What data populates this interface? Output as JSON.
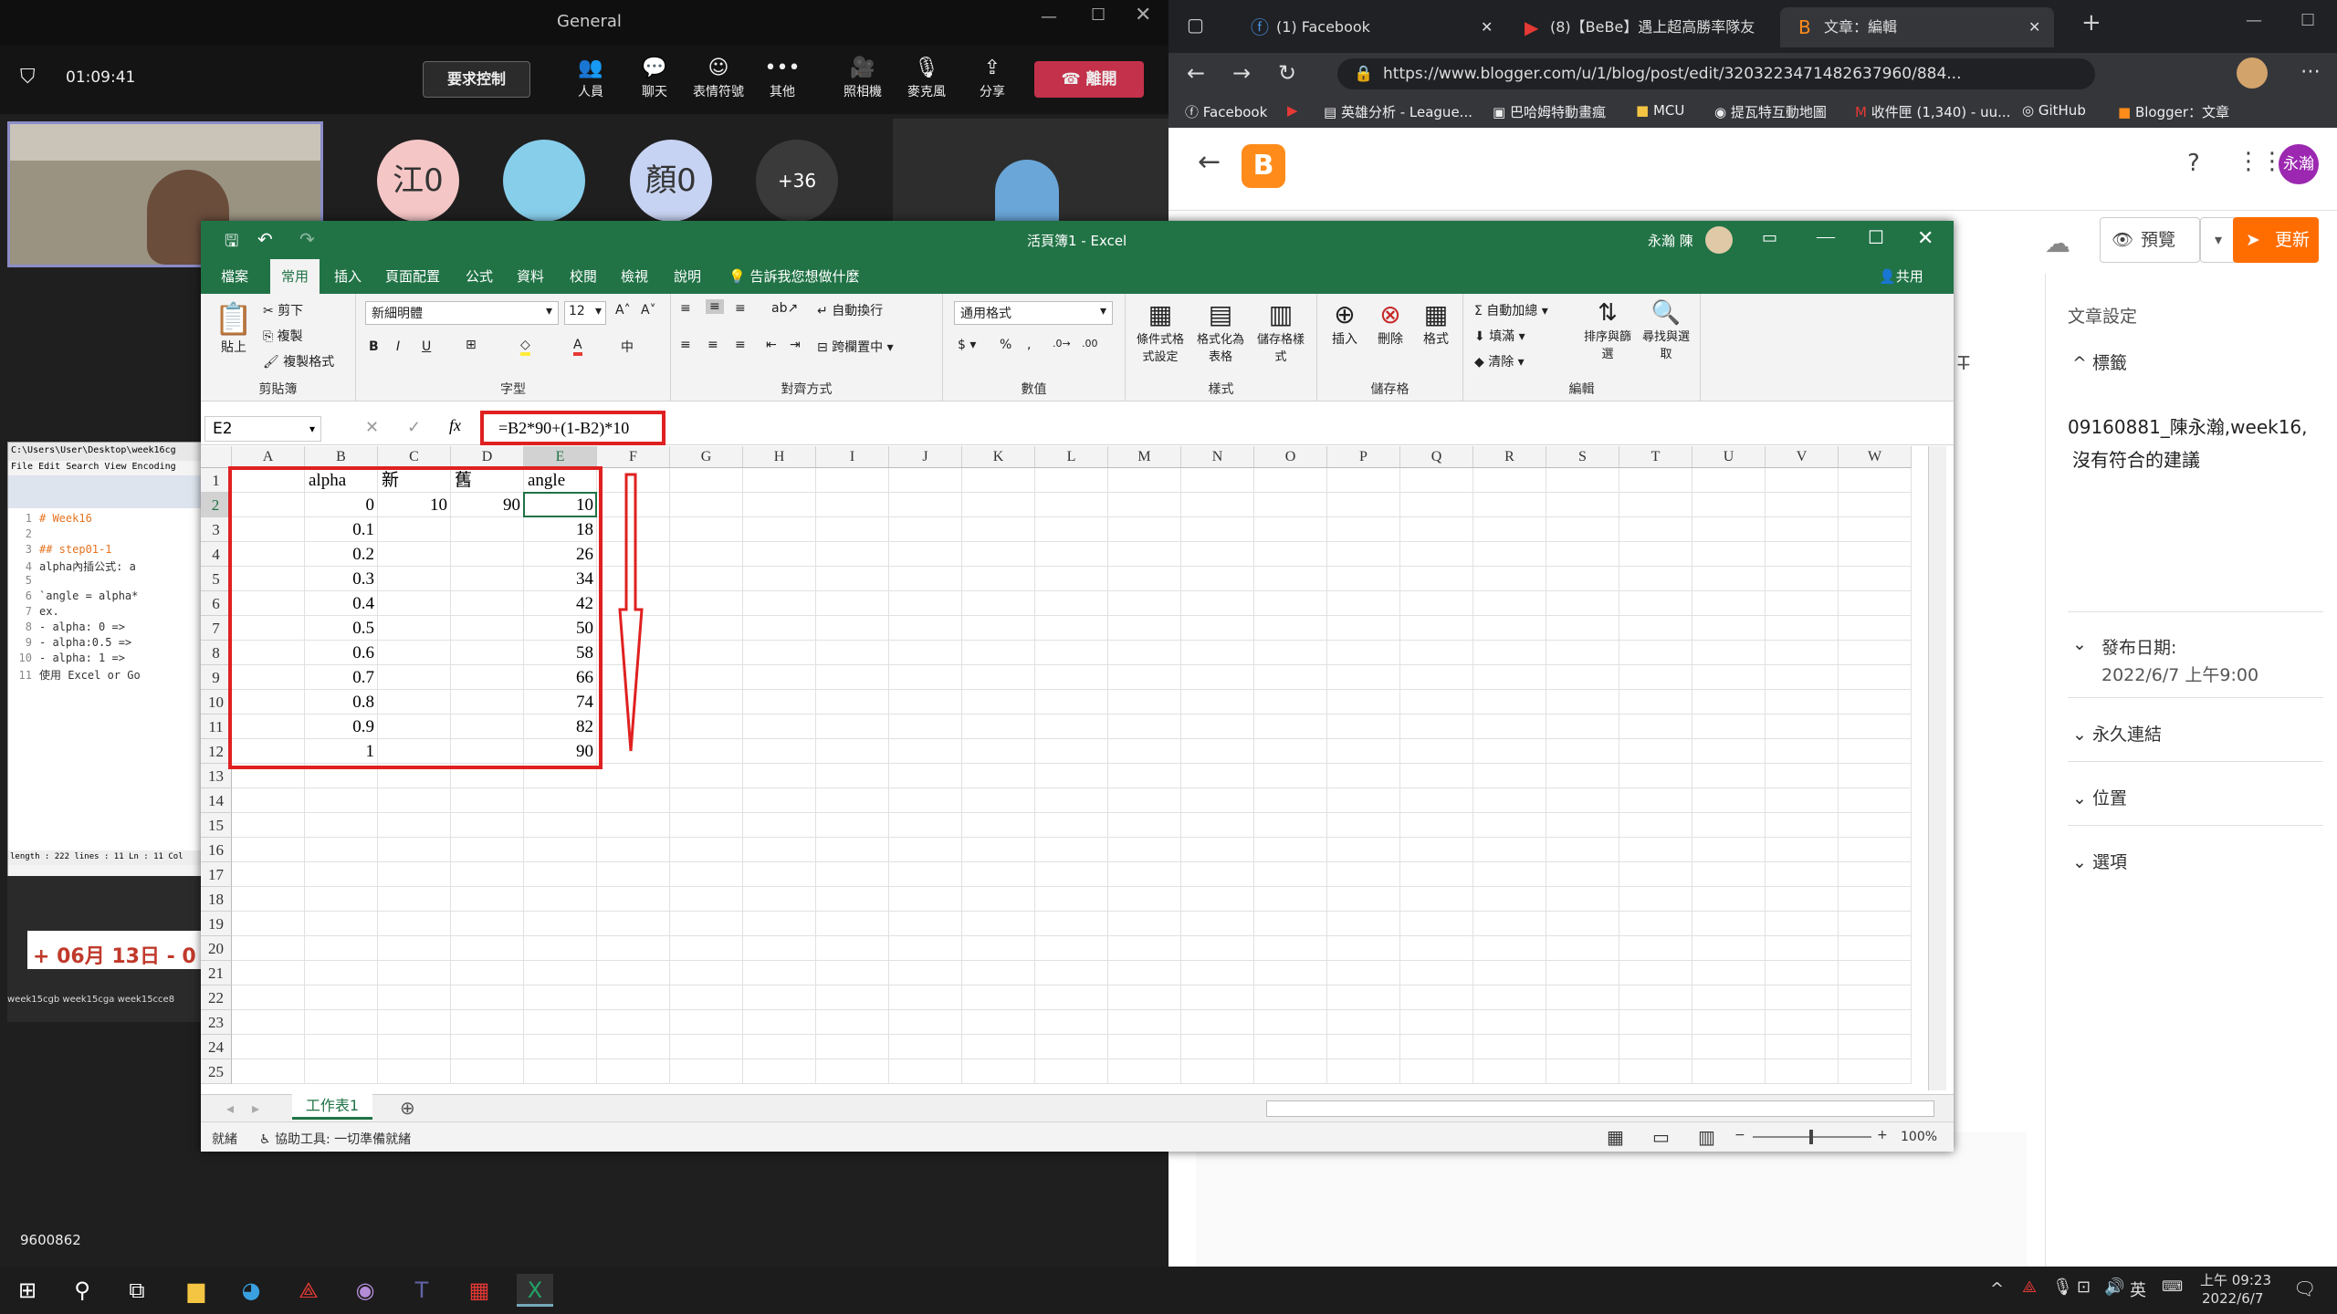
{
  "teams": {
    "title": "General",
    "timer": "01:09:41",
    "request_control": "要求控制",
    "buttons": [
      {
        "label": "人員",
        "icon": "people-icon"
      },
      {
        "label": "聊天",
        "icon": "chat-icon"
      },
      {
        "label": "表情符號",
        "icon": "emoji-icon"
      },
      {
        "label": "其他",
        "icon": "more-icon"
      },
      {
        "label": "照相機",
        "icon": "camera-off-icon"
      },
      {
        "label": "麥克風",
        "icon": "mic-off-icon"
      },
      {
        "label": "分享",
        "icon": "share-icon"
      }
    ],
    "leave": "離開",
    "participants": [
      {
        "label": "江0",
        "color": "#f5c6c6"
      },
      {
        "label": "",
        "color": "#87ceeb"
      },
      {
        "label": "顏0",
        "color": "#c7d3f2"
      },
      {
        "label": "+36",
        "color": "#3a3a3a"
      }
    ],
    "bottom_id": "9600862"
  },
  "excel": {
    "title": "活頁簿1 - Excel",
    "user": "永瀚 陳",
    "share": "共用",
    "tabs": [
      "檔案",
      "常用",
      "插入",
      "頁面配置",
      "公式",
      "資料",
      "校閱",
      "檢視",
      "說明"
    ],
    "tell_me": "告訴我您想做什麼",
    "ribbon": {
      "clipboard": {
        "label": "剪貼簿",
        "paste": "貼上",
        "cut": "剪下",
        "copy": "複製",
        "format_painter": "複製格式"
      },
      "font": {
        "label": "字型",
        "name": "新細明體",
        "size": "12"
      },
      "alignment": {
        "label": "對齊方式",
        "wrap": "自動換行",
        "merge": "跨欄置中"
      },
      "number": {
        "label": "數值",
        "format": "通用格式"
      },
      "styles": {
        "label": "樣式",
        "cond": "條件式格式設定",
        "table": "格式化為表格",
        "cell": "儲存格樣式"
      },
      "cells": {
        "label": "儲存格",
        "insert": "插入",
        "delete": "刪除",
        "format": "格式"
      },
      "editing": {
        "label": "編輯",
        "autosum": "自動加總",
        "fill": "填滿",
        "clear": "清除",
        "sort": "排序與篩選",
        "find": "尋找與選取"
      }
    },
    "name_box": "E2",
    "formula": "=B2*90+(1-B2)*10",
    "columns": [
      "A",
      "B",
      "C",
      "D",
      "E",
      "F",
      "G",
      "H",
      "I",
      "J",
      "K",
      "L",
      "M",
      "N",
      "O",
      "P",
      "Q",
      "R",
      "S",
      "T",
      "U",
      "V",
      "W"
    ],
    "rows": [
      "1",
      "2",
      "3",
      "4",
      "5",
      "6",
      "7",
      "8",
      "9",
      "10",
      "11",
      "12",
      "13",
      "14",
      "15",
      "16",
      "17",
      "18",
      "19",
      "20",
      "21",
      "22",
      "23",
      "24",
      "25"
    ],
    "headers": {
      "B1": "alpha",
      "C1": "新",
      "D1": "舊",
      "E1": "angle"
    },
    "C2": "10",
    "D2": "90",
    "alpha": [
      "0",
      "0.1",
      "0.2",
      "0.3",
      "0.4",
      "0.5",
      "0.6",
      "0.7",
      "0.8",
      "0.9",
      "1"
    ],
    "angle": [
      "10",
      "18",
      "26",
      "34",
      "42",
      "50",
      "58",
      "66",
      "74",
      "82",
      "90"
    ],
    "sheet_tab": "工作表1",
    "status_ready": "就緒",
    "accessibility": "協助工具: 一切準備就緒",
    "zoom": "100%"
  },
  "notepad": {
    "path": "C:\\Users\\User\\Desktop\\week16cg",
    "menu": [
      "File",
      "Edit",
      "Search",
      "View",
      "Encoding"
    ],
    "lines": [
      "# Week16",
      "",
      "## step01-1",
      "alpha內插公式: a",
      "",
      "`angle = alpha*",
      "ex.",
      "- alpha: 0  =>",
      "- alpha:0.5 =>",
      "- alpha: 1  =>",
      "使用 Excel or Go"
    ],
    "status": "length : 222   lines : 11   Ln : 11   Col",
    "date_banner": "06月 13日 - 0",
    "folders": [
      "week15cgb",
      "week15cga",
      "week15cce8"
    ]
  },
  "browser": {
    "tabs": [
      {
        "label": "(1) Facebook"
      },
      {
        "label": "(8)【BeBe】遇上超高勝率隊友"
      },
      {
        "label": "文章：編輯"
      }
    ],
    "url": "https://www.blogger.com/u/1/blog/post/edit/3203223471482637960/884...",
    "bookmarks": [
      "Facebook",
      "",
      "英雄分析 - League...",
      "巴哈姆特動畫瘋",
      "MCU",
      "提瓦特互動地圖",
      "收件匣 (1,340) - uu...",
      "GitHub",
      "Blogger：文章"
    ],
    "preview": "預覽",
    "update": "更新",
    "settings_title": "文章設定",
    "labels_title": "標籤",
    "labels_value": "09160881_陳永瀚,week16,",
    "no_suggestions": "沒有符合的建議",
    "publish_title": "發布日期:",
    "publish_value": "2022/6/7 上午9:00",
    "permalink": "永久連結",
    "location": "位置",
    "options": "選項",
    "avatar": "永瀚"
  },
  "taskbar": {
    "ime": "英",
    "time": "上午 09:23",
    "date": "2022/6/7"
  }
}
